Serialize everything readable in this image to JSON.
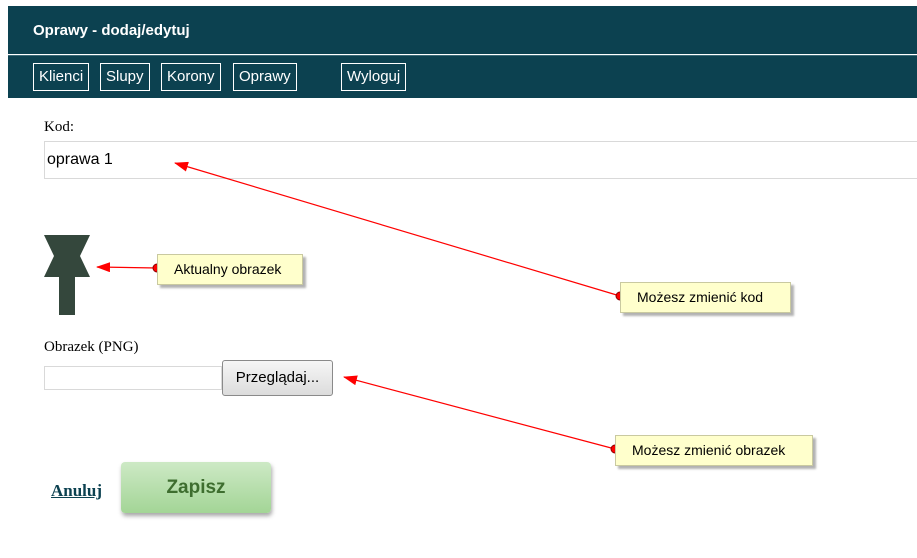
{
  "header": {
    "title": "Oprawy - dodaj/edytuj"
  },
  "nav": {
    "items": [
      {
        "label": "Klienci"
      },
      {
        "label": "Slupy"
      },
      {
        "label": "Korony"
      },
      {
        "label": "Oprawy"
      },
      {
        "label": "Wyloguj"
      }
    ]
  },
  "form": {
    "kod_label": "Kod:",
    "kod_value": "oprawa 1",
    "image_label": "Obrazek (PNG)",
    "file_path_value": "",
    "browse_label": "Przeglądaj...",
    "cancel_label": "Anuluj",
    "save_label": "Zapisz"
  },
  "annotations": {
    "current_image": "Aktualny obrazek",
    "change_code": "Możesz zmienić kod",
    "change_image": "Możesz zmienić obrazek"
  },
  "colors": {
    "header_bg": "#0c4150",
    "save_bg": "#a3d596",
    "callout_bg": "#ffffcc",
    "arrow": "#ff0000",
    "image_fill": "#34473c"
  }
}
